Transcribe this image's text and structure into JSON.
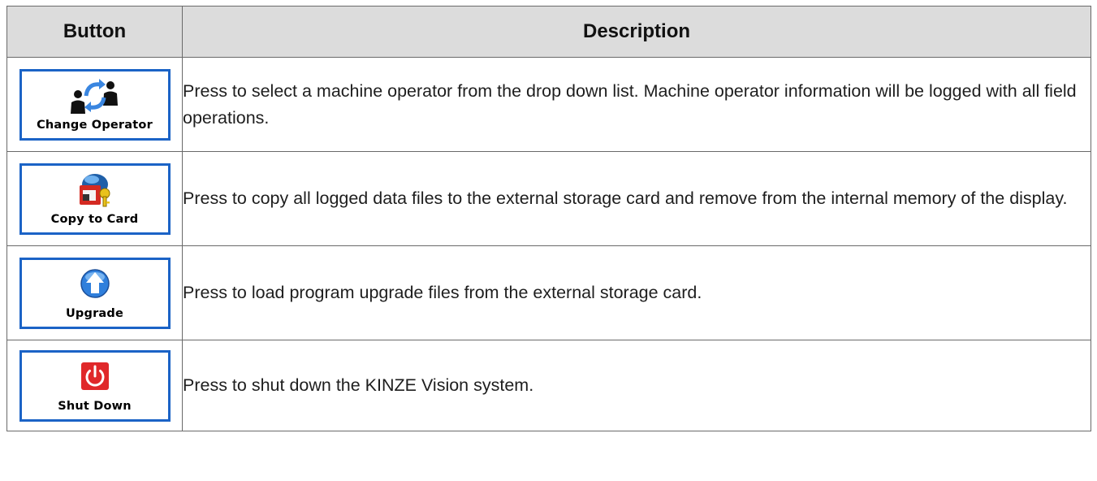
{
  "table": {
    "headers": {
      "button": "Button",
      "description": "Description"
    },
    "rows": [
      {
        "button_label": "Change Operator",
        "icon": "change-operator-icon",
        "description": "Press to select a machine operator from the drop down list. Machine operator information will be logged with all field operations."
      },
      {
        "button_label": "Copy to Card",
        "icon": "copy-to-card-icon",
        "description": "Press to copy all logged data files to the external storage card and remove from the internal memory of the display."
      },
      {
        "button_label": "Upgrade",
        "icon": "upgrade-arrow-icon",
        "description": "Press to load program upgrade files from the external storage card."
      },
      {
        "button_label": "Shut Down",
        "icon": "power-icon",
        "description": "Press to shut down the KINZE Vision system."
      }
    ]
  },
  "colors": {
    "button_border": "#1b63c6",
    "header_bg": "#dcdcdc",
    "power_red": "#e0282a",
    "upgrade_blue": "#2f7fdc"
  }
}
